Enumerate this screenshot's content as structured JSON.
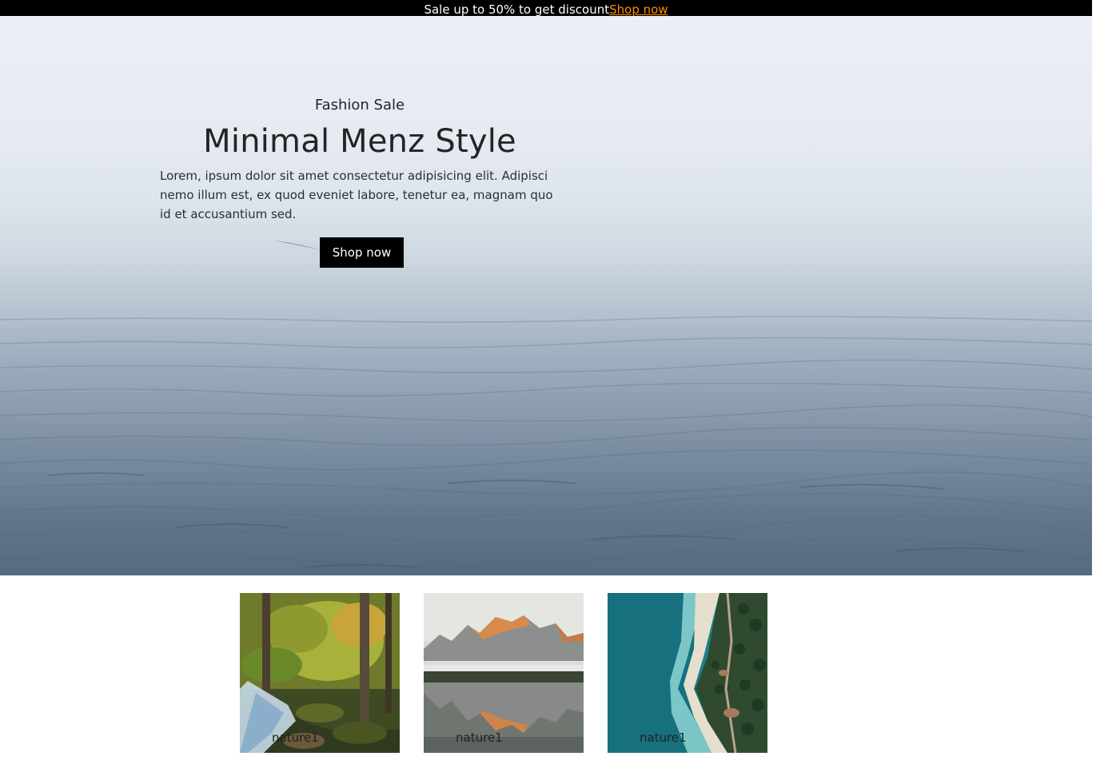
{
  "announcement": {
    "text": "Sale up to 50% to get discount",
    "link_label": "Shop now"
  },
  "hero": {
    "eyebrow": "Fashion Sale",
    "title": "Minimal Menz Style",
    "description": "Lorem, ipsum dolor sit amet consectetur adipisicing elit. Adipisci nemo illum est, ex quod eveniet labore, tenetur ea, magnam quo id et accusantium sed.",
    "button_label": "Shop now",
    "background": "foggy sea"
  },
  "gallery": [
    {
      "caption": "nature1",
      "scene": "forest waterfall"
    },
    {
      "caption": "nature1",
      "scene": "mountain lake reflection"
    },
    {
      "caption": "nature1",
      "scene": "aerial turquoise coastline"
    }
  ],
  "colors": {
    "topbar_bg": "#000000",
    "link_accent": "#ff8c00",
    "button_bg": "#000000",
    "button_text": "#ffffff",
    "heading_text": "#222428"
  }
}
